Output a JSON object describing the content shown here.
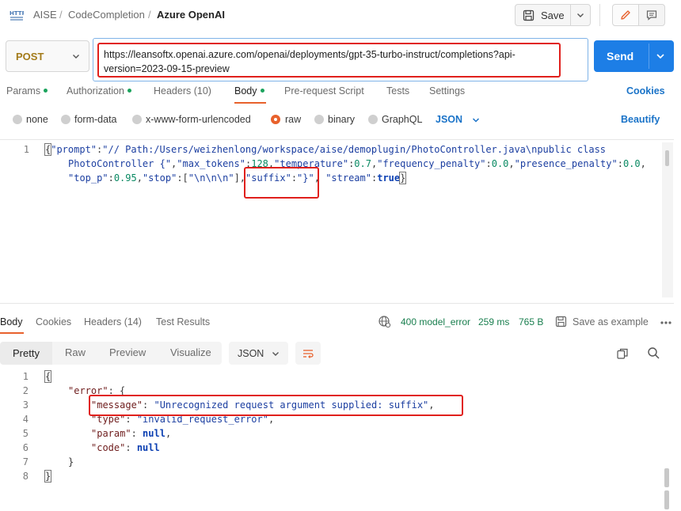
{
  "breadcrumb": {
    "items": [
      "AISE",
      "CodeCompletion"
    ],
    "current": "Azure OpenAI",
    "separator": "/"
  },
  "header": {
    "save_label": "Save"
  },
  "request": {
    "method": "POST",
    "url_line1": "https://leansoftx.openai.azure.com/openai/deployments/gpt-35-turbo-instruct/completions?api-",
    "url_line2": "version=2023-09-15-preview",
    "send_label": "Send"
  },
  "request_tabs": {
    "params": "Params",
    "authorization": "Authorization",
    "headers": "Headers (10)",
    "body": "Body",
    "pre_request": "Pre-request Script",
    "tests": "Tests",
    "settings": "Settings",
    "cookies": "Cookies"
  },
  "body_types": {
    "none": "none",
    "form_data": "form-data",
    "urlencoded": "x-www-form-urlencoded",
    "raw": "raw",
    "binary": "binary",
    "graphql": "GraphQL",
    "language": "JSON",
    "beautify": "Beautify"
  },
  "request_body": {
    "line_number": "1",
    "line1_a": "{",
    "line1_b": "\"prompt\"",
    "line1_c": ":",
    "line1_d": "\"// Path:/Users/weizhenlong/workspace/aise/demoplugin/PhotoController.java\\npublic class",
    "line2_a": "PhotoController {\"",
    "line2_b": ",",
    "line2_c": "\"max_tokens\"",
    "line2_d": ":",
    "line2_e": "128",
    "line2_f": ",",
    "line2_g": "\"temperature\"",
    "line2_h": ":",
    "line2_i": "0.7",
    "line2_j": ",",
    "line2_k": "\"frequency_penalty\"",
    "line2_l": ":",
    "line2_m": "0.0",
    "line2_n": ",",
    "line2_o": "\"presence_penalty\"",
    "line2_p": ":",
    "line2_q": "0.0",
    "line2_r": ",",
    "line3_a": "\"top_p\"",
    "line3_b": ":",
    "line3_c": "0.95",
    "line3_d": ",",
    "line3_e": "\"stop\"",
    "line3_f": ":[",
    "line3_g": "\"\\n\\n\\n\"",
    "line3_h": "],",
    "line3_i": "\"suffix\"",
    "line3_j": ":",
    "line3_k": "\"}\"",
    "line3_l": ", ",
    "line3_m": "\"stream\"",
    "line3_n": ":",
    "line3_o": "true",
    "line3_p": "}"
  },
  "response_tabs": {
    "body": "Body",
    "cookies": "Cookies",
    "headers": "Headers (14)",
    "test_results": "Test Results"
  },
  "response_status": {
    "status": "400 model_error",
    "time": "259 ms",
    "size": "765 B",
    "save_example": "Save as example"
  },
  "response_toolbar": {
    "pretty": "Pretty",
    "raw": "Raw",
    "preview": "Preview",
    "visualize": "Visualize",
    "format": "JSON"
  },
  "response_body": {
    "lines": [
      "1",
      "2",
      "3",
      "4",
      "5",
      "6",
      "7",
      "8"
    ],
    "l1": "{",
    "l2_key": "\"error\"",
    "l2_rest": ": {",
    "l3_key": "\"message\"",
    "l3_sep": ": ",
    "l3_val": "\"Unrecognized request argument supplied: suffix\"",
    "l3_end": ",",
    "l4_key": "\"type\"",
    "l4_sep": ": ",
    "l4_val": "\"invalid_request_error\"",
    "l4_end": ",",
    "l5_key": "\"param\"",
    "l5_sep": ": ",
    "l5_val": "null",
    "l5_end": ",",
    "l6_key": "\"code\"",
    "l6_sep": ": ",
    "l6_val": "null",
    "l7": "}",
    "l8": "}"
  },
  "colors": {
    "accent": "#e8612c",
    "send": "#1d7ee6",
    "link": "#1a73c8",
    "status_error": "#1a7f4f",
    "highlight": "#e0201c"
  }
}
